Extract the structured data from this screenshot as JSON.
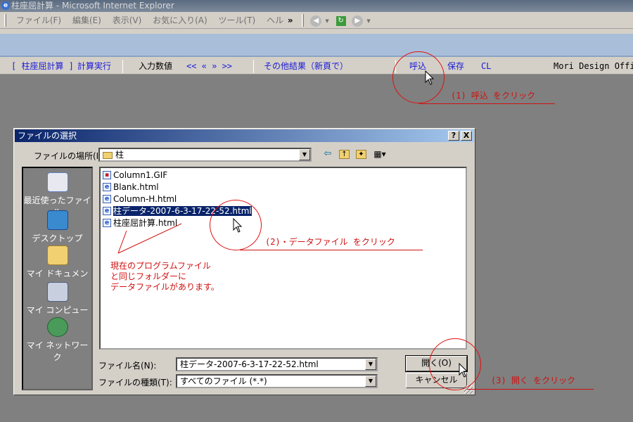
{
  "window": {
    "title": "柱座屈計算 - Microsoft Internet Explorer"
  },
  "menu": [
    "ファイル(F)",
    "編集(E)",
    "表示(V)",
    "お気に入り(A)",
    "ツール(T)",
    "ヘル"
  ],
  "menu_overflow": "»",
  "navbar": {
    "title_link": "[ 柱座屈計算 ]",
    "calc": "計算実行",
    "input_label": "入力数値",
    "arrows": "<< « » >>",
    "other": "その他結果（新頁で）",
    "load": "呼込",
    "save": "保存",
    "clear": "CL",
    "brand": "Mori Design Offi"
  },
  "annotations": {
    "step1": "(1) 呼込 をクリック",
    "step2": "(2)・データファイル をクリック",
    "step3": "(3) 開く をクリック",
    "note_line1": "現在のプログラムファイル",
    "note_line2": "と同じフォルダーに",
    "note_line3": "データファイルがあります。"
  },
  "dialog": {
    "title": "ファイルの選択",
    "help_btn": "?",
    "close_btn": "X",
    "location_label": "ファイルの場所(I):",
    "location_value": "柱",
    "places": [
      "最近使ったファイル",
      "デスクトップ",
      "マイ ドキュメント",
      "マイ コンピュータ",
      "マイ ネットワーク"
    ],
    "files": [
      "Column1.GIF",
      "Blank.html",
      "Column-H.html",
      "柱データ-2007-6-3-17-22-52.html",
      "柱座屈計算.html"
    ],
    "selected_file_index": 3,
    "filename_label": "ファイル名(N):",
    "filename_value": "柱データ-2007-6-3-17-22-52.html",
    "filetype_label": "ファイルの種類(T):",
    "filetype_value": "すべてのファイル (*.*)",
    "open_btn": "開く(O)",
    "cancel_btn": "キャンセル"
  },
  "colors": {
    "annotation": "#d01010",
    "link": "#1a1ad8",
    "selection": "#0a246a"
  }
}
